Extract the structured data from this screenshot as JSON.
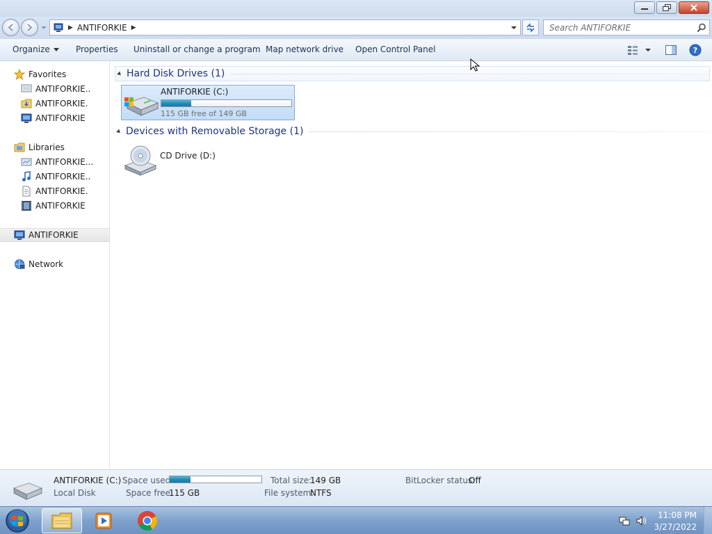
{
  "window": {
    "controls": {
      "minimize": "minimize",
      "restore": "restore",
      "close": "close"
    }
  },
  "address": {
    "crumbs": [
      "ANTIFORKIE"
    ],
    "search_placeholder": "Search ANTIFORKIE"
  },
  "toolbar": {
    "organize": "Organize",
    "properties": "Properties",
    "uninstall": "Uninstall or change a program",
    "map_drive": "Map network drive",
    "control_panel": "Open Control Panel"
  },
  "nav": {
    "favorites": "Favorites",
    "favorites_items": [
      "ANTIFORKIE..",
      "ANTIFORKIE.",
      "ANTIFORKIE"
    ],
    "libraries": "Libraries",
    "libraries_items": [
      "ANTIFORKIE...",
      "ANTIFORKIE..",
      "ANTIFORKIE.",
      "ANTIFORKIE"
    ],
    "computer": "ANTIFORKIE",
    "network": "Network"
  },
  "groups": {
    "hard_disks": "Hard Disk Drives (1)",
    "removable": "Devices with Removable Storage (1)"
  },
  "drives": {
    "c": {
      "name": "ANTIFORKIE (C:)",
      "free_text": "115 GB free of 149 GB",
      "used_fraction": 0.228
    },
    "d": {
      "name": "CD Drive (D:)"
    }
  },
  "details": {
    "name": "ANTIFORKIE (C:)",
    "type": "Local Disk",
    "space_used_label": "Space used:",
    "space_used_fraction": 0.228,
    "space_free_label": "Space free:",
    "space_free": "115 GB",
    "total_size_label": "Total size:",
    "total_size": "149 GB",
    "file_system_label": "File system:",
    "file_system": "NTFS",
    "bitlocker_label": "BitLocker status:",
    "bitlocker": "Off"
  },
  "taskbar": {
    "time": "11:08 PM",
    "date": "3/27/2022"
  }
}
